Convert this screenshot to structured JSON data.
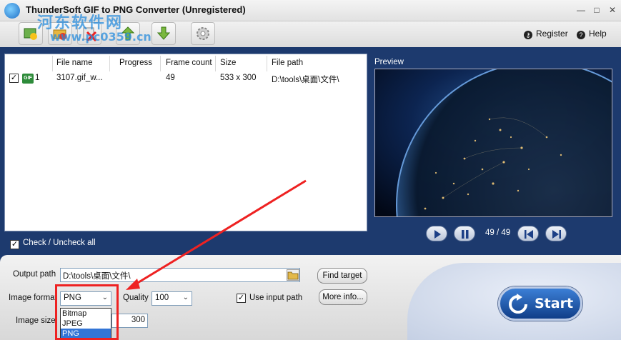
{
  "window": {
    "title": "ThunderSoft GIF to PNG Converter (Unregistered)",
    "minimize": "—",
    "maximize": "□",
    "close": "✕"
  },
  "watermark": {
    "line1": "河东软件网",
    "line2": "www.pc0359.cn"
  },
  "toolbar": {
    "buttons": [
      "add-image-icon",
      "add-folder-icon",
      "remove-icon",
      "clear-icon",
      "download-icon",
      "settings-icon"
    ],
    "register": "Register",
    "help": "Help"
  },
  "file_list": {
    "columns": [
      "File name",
      "Progress",
      "Frame count",
      "Size",
      "File path"
    ],
    "rows": [
      {
        "index": "1",
        "file_name": "3107.gif_w...",
        "progress": "",
        "frame_count": "49",
        "size": "533 x 300",
        "file_path": "D:\\tools\\桌面\\文件\\",
        "checked": true,
        "icon_text": "GIF"
      }
    ],
    "check_all_label": "Check / Uncheck all"
  },
  "preview": {
    "label": "Preview",
    "frame_text": "49 / 49"
  },
  "settings": {
    "output_path_label": "Output path",
    "output_path_value": "D:\\tools\\桌面\\文件\\",
    "find_target": "Find target",
    "image_format_label": "Image format",
    "image_format_value": "PNG",
    "format_options": [
      "Bitmap",
      "JPEG",
      "PNG"
    ],
    "quality_label": "Quality",
    "quality_value": "100",
    "use_input_path_label": "Use input path",
    "more_info": "More info...",
    "image_size_label": "Image size",
    "image_size_value": "300"
  },
  "start_label": "Start",
  "colors": {
    "accent": "#1d3a6e",
    "highlight": "#ee2222",
    "selection": "#3375d6"
  }
}
